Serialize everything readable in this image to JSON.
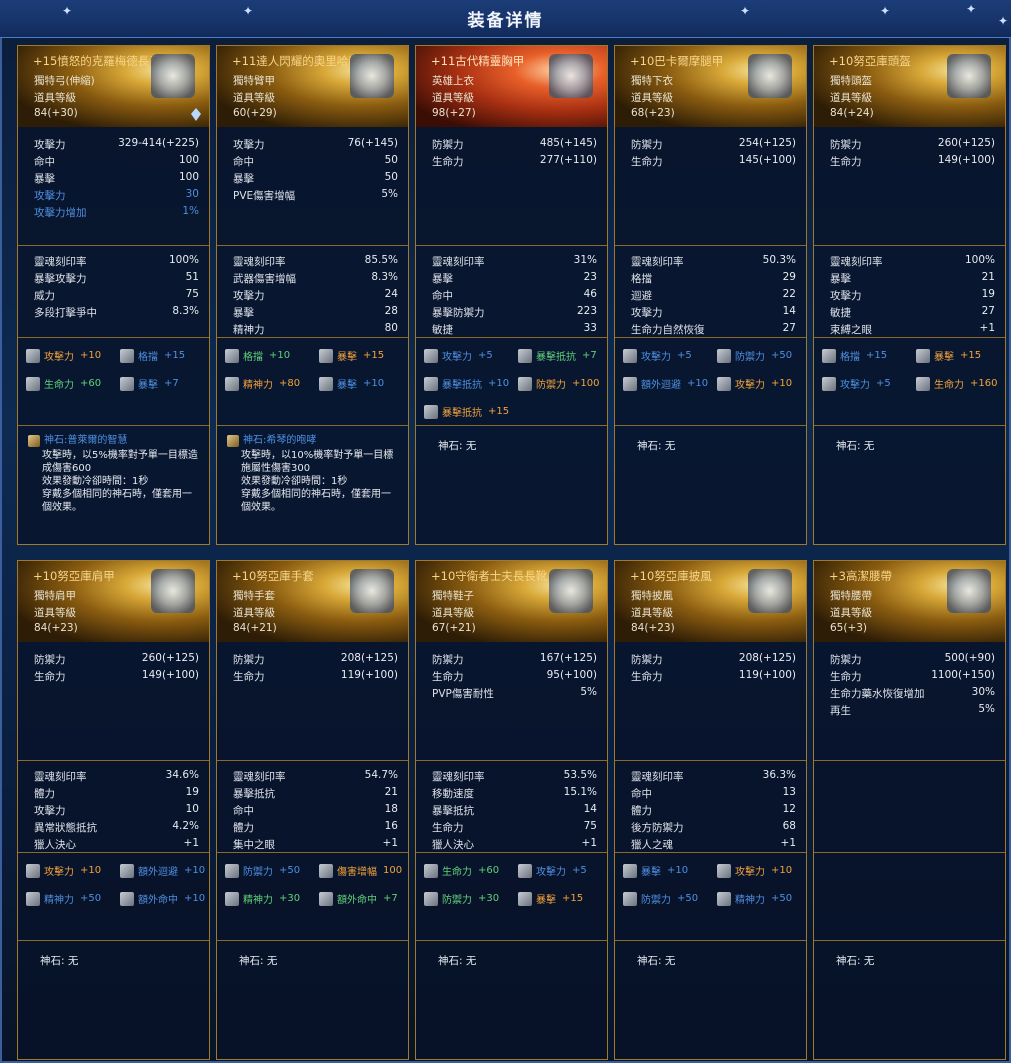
{
  "title": "装备详情",
  "cards": [
    {
      "name": "+15憤怒的克羅梅德長弓",
      "type": "獨特弓(伸縮)",
      "itemlevel_label": "道具等級",
      "level": "84(+30)",
      "red": false,
      "gem": true,
      "stats": [
        {
          "k": "攻擊力",
          "v": "329-414(+225)"
        },
        {
          "k": "命中",
          "v": "100"
        },
        {
          "k": "暴擊",
          "v": "100"
        },
        {
          "k": "攻擊力",
          "v": "30",
          "c": "blue"
        },
        {
          "k": "攻擊力增加",
          "v": "1%",
          "c": "blue"
        }
      ],
      "soul": [
        {
          "k": "靈魂刻印率",
          "v": "100%"
        },
        {
          "k": "暴擊攻擊力",
          "v": "51"
        },
        {
          "k": "威力",
          "v": "75"
        },
        {
          "k": "多段打擊爭中",
          "v": "8.3%"
        }
      ],
      "manastones": [
        {
          "n": "攻擊力",
          "v": "+10",
          "c": "or"
        },
        {
          "n": "格擋",
          "v": "+15",
          "c": "bl"
        },
        {
          "n": "生命力",
          "v": "+60",
          "c": "gr"
        },
        {
          "n": "暴擊",
          "v": "+7",
          "c": "bl"
        }
      ],
      "godstone": {
        "label": "神石:",
        "name": "普萊爾的智慧",
        "desc": "攻擊時，以5%機率對予單一目標造成傷害600\n效果發動冷卻時間：1秒\n穿戴多個相同的神石時，僅套用一個效果。"
      }
    },
    {
      "name": "+11達人閃耀的奧里哈康鐵甲",
      "type": "獨特臂甲",
      "itemlevel_label": "道具等級",
      "level": "60(+29)",
      "red": false,
      "gem": false,
      "stats": [
        {
          "k": "攻擊力",
          "v": "76(+145)"
        },
        {
          "k": "命中",
          "v": "50"
        },
        {
          "k": "暴擊",
          "v": "50"
        },
        {
          "k": "PVE傷害增幅",
          "v": "5%"
        }
      ],
      "soul": [
        {
          "k": "靈魂刻印率",
          "v": "85.5%"
        },
        {
          "k": "武器傷害增幅",
          "v": "8.3%"
        },
        {
          "k": "攻擊力",
          "v": "24"
        },
        {
          "k": "暴擊",
          "v": "28"
        },
        {
          "k": "精神力",
          "v": "80"
        }
      ],
      "manastones": [
        {
          "n": "格擋",
          "v": "+10",
          "c": "gr"
        },
        {
          "n": "暴擊",
          "v": "+15",
          "c": "or"
        },
        {
          "n": "精神力",
          "v": "+80",
          "c": "or"
        },
        {
          "n": "暴擊",
          "v": "+10",
          "c": "bl"
        }
      ],
      "godstone": {
        "label": "神石:",
        "name": "希琴的咆哮",
        "desc": "攻擊時，以10%機率對予單一目標施屬性傷害300\n效果發動冷卻時間：1秒\n穿戴多個相同的神石時，僅套用一個效果。"
      }
    },
    {
      "name": "+11古代精靈胸甲",
      "type": "英雄上衣",
      "itemlevel_label": "道具等級",
      "level": "98(+27)",
      "red": true,
      "gem": false,
      "stats": [
        {
          "k": "防禦力",
          "v": "485(+145)"
        },
        {
          "k": "生命力",
          "v": "277(+110)"
        }
      ],
      "soul": [
        {
          "k": "靈魂刻印率",
          "v": "31%"
        },
        {
          "k": "暴擊",
          "v": "23"
        },
        {
          "k": "命中",
          "v": "46"
        },
        {
          "k": "暴擊防禦力",
          "v": "223"
        },
        {
          "k": "敏捷",
          "v": "33"
        }
      ],
      "manastones": [
        {
          "n": "攻擊力",
          "v": "+5",
          "c": "bl"
        },
        {
          "n": "暴擊抵抗",
          "v": "+7",
          "c": "gr"
        },
        {
          "n": "暴擊抵抗",
          "v": "+10",
          "c": "bl"
        },
        {
          "n": "防禦力",
          "v": "+100",
          "c": "or"
        },
        {
          "n": "暴擊抵抗",
          "v": "+15",
          "c": "or"
        }
      ],
      "godstone": {
        "label": "神石:",
        "value": "无"
      }
    },
    {
      "name": "+10巴卡爾摩腿甲",
      "type": "獨特下衣",
      "itemlevel_label": "道具等級",
      "level": "68(+23)",
      "red": false,
      "gem": false,
      "stats": [
        {
          "k": "防禦力",
          "v": "254(+125)"
        },
        {
          "k": "生命力",
          "v": "145(+100)"
        }
      ],
      "soul": [
        {
          "k": "靈魂刻印率",
          "v": "50.3%"
        },
        {
          "k": "格擋",
          "v": "29"
        },
        {
          "k": "迴避",
          "v": "22"
        },
        {
          "k": "攻擊力",
          "v": "14"
        },
        {
          "k": "生命力自然恢復",
          "v": "27"
        }
      ],
      "manastones": [
        {
          "n": "攻擊力",
          "v": "+5",
          "c": "bl"
        },
        {
          "n": "防禦力",
          "v": "+50",
          "c": "bl"
        },
        {
          "n": "額外迴避",
          "v": "+10",
          "c": "bl"
        },
        {
          "n": "攻擊力",
          "v": "+10",
          "c": "or"
        }
      ],
      "godstone": {
        "label": "神石:",
        "value": "无"
      }
    },
    {
      "name": "+10努亞庫頭盔",
      "type": "獨特頭盔",
      "itemlevel_label": "道具等級",
      "level": "84(+24)",
      "red": false,
      "gem": false,
      "stats": [
        {
          "k": "防禦力",
          "v": "260(+125)"
        },
        {
          "k": "生命力",
          "v": "149(+100)"
        }
      ],
      "soul": [
        {
          "k": "靈魂刻印率",
          "v": "100%"
        },
        {
          "k": "暴擊",
          "v": "21"
        },
        {
          "k": "攻擊力",
          "v": "19"
        },
        {
          "k": "敏捷",
          "v": "27"
        },
        {
          "k": "束縛之眼",
          "v": "+1"
        }
      ],
      "manastones": [
        {
          "n": "格擋",
          "v": "+15",
          "c": "bl"
        },
        {
          "n": "暴擊",
          "v": "+15",
          "c": "or"
        },
        {
          "n": "攻擊力",
          "v": "+5",
          "c": "bl"
        },
        {
          "n": "生命力",
          "v": "+160",
          "c": "or"
        }
      ],
      "godstone": {
        "label": "神石:",
        "value": "无"
      }
    },
    {
      "name": "+10努亞庫肩甲",
      "type": "獨特肩甲",
      "itemlevel_label": "道具等級",
      "level": "84(+23)",
      "red": false,
      "gem": false,
      "stats": [
        {
          "k": "防禦力",
          "v": "260(+125)"
        },
        {
          "k": "生命力",
          "v": "149(+100)"
        }
      ],
      "soul": [
        {
          "k": "靈魂刻印率",
          "v": "34.6%"
        },
        {
          "k": "體力",
          "v": "19"
        },
        {
          "k": "攻擊力",
          "v": "10"
        },
        {
          "k": "異常狀態抵抗",
          "v": "4.2%"
        },
        {
          "k": "獵人決心",
          "v": "+1"
        }
      ],
      "manastones": [
        {
          "n": "攻擊力",
          "v": "+10",
          "c": "or"
        },
        {
          "n": "額外迴避",
          "v": "+10",
          "c": "bl"
        },
        {
          "n": "精神力",
          "v": "+50",
          "c": "bl"
        },
        {
          "n": "額外命中",
          "v": "+10",
          "c": "bl"
        }
      ],
      "godstone": {
        "label": "神石:",
        "value": "无"
      }
    },
    {
      "name": "+10努亞庫手套",
      "type": "獨特手套",
      "itemlevel_label": "道具等級",
      "level": "84(+21)",
      "red": false,
      "gem": false,
      "stats": [
        {
          "k": "防禦力",
          "v": "208(+125)"
        },
        {
          "k": "生命力",
          "v": "119(+100)"
        }
      ],
      "soul": [
        {
          "k": "靈魂刻印率",
          "v": "54.7%"
        },
        {
          "k": "暴擊抵抗",
          "v": "21"
        },
        {
          "k": "命中",
          "v": "18"
        },
        {
          "k": "體力",
          "v": "16"
        },
        {
          "k": "集中之眼",
          "v": "+1"
        }
      ],
      "manastones": [
        {
          "n": "防禦力",
          "v": "+50",
          "c": "bl"
        },
        {
          "n": "傷害增幅",
          "v": "100",
          "c": "or"
        },
        {
          "n": "精神力",
          "v": "+30",
          "c": "gr"
        },
        {
          "n": "額外命中",
          "v": "+7",
          "c": "gr"
        }
      ],
      "godstone": {
        "label": "神石:",
        "value": "无"
      }
    },
    {
      "name": "+10守衛者士夫長長靴",
      "type": "獨特鞋子",
      "itemlevel_label": "道具等級",
      "level": "67(+21)",
      "red": false,
      "gem": false,
      "stats": [
        {
          "k": "防禦力",
          "v": "167(+125)"
        },
        {
          "k": "生命力",
          "v": "95(+100)"
        },
        {
          "k": "PVP傷害耐性",
          "v": "5%"
        }
      ],
      "soul": [
        {
          "k": "靈魂刻印率",
          "v": "53.5%"
        },
        {
          "k": "移動速度",
          "v": "15.1%"
        },
        {
          "k": "暴擊抵抗",
          "v": "14"
        },
        {
          "k": "生命力",
          "v": "75"
        },
        {
          "k": "獵人決心",
          "v": "+1"
        }
      ],
      "manastones": [
        {
          "n": "生命力",
          "v": "+60",
          "c": "gr"
        },
        {
          "n": "攻擊力",
          "v": "+5",
          "c": "bl"
        },
        {
          "n": "防禦力",
          "v": "+30",
          "c": "gr"
        },
        {
          "n": "暴擊",
          "v": "+15",
          "c": "or"
        }
      ],
      "godstone": {
        "label": "神石:",
        "value": "无"
      }
    },
    {
      "name": "+10努亞庫披風",
      "type": "獨特披風",
      "itemlevel_label": "道具等級",
      "level": "84(+23)",
      "red": false,
      "gem": false,
      "stats": [
        {
          "k": "防禦力",
          "v": "208(+125)"
        },
        {
          "k": "生命力",
          "v": "119(+100)"
        }
      ],
      "soul": [
        {
          "k": "靈魂刻印率",
          "v": "36.3%"
        },
        {
          "k": "命中",
          "v": "13"
        },
        {
          "k": "體力",
          "v": "12"
        },
        {
          "k": "後方防禦力",
          "v": "68"
        },
        {
          "k": "獵人之魂",
          "v": "+1"
        }
      ],
      "manastones": [
        {
          "n": "暴擊",
          "v": "+10",
          "c": "bl"
        },
        {
          "n": "攻擊力",
          "v": "+10",
          "c": "or"
        },
        {
          "n": "防禦力",
          "v": "+50",
          "c": "bl"
        },
        {
          "n": "精神力",
          "v": "+50",
          "c": "bl"
        }
      ],
      "godstone": {
        "label": "神石:",
        "value": "无"
      }
    },
    {
      "name": "+3高潔腰帶",
      "type": "獨特腰帶",
      "itemlevel_label": "道具等級",
      "level": "65(+3)",
      "red": false,
      "gem": false,
      "stats": [
        {
          "k": "防禦力",
          "v": "500(+90)"
        },
        {
          "k": "生命力",
          "v": "1100(+150)"
        },
        {
          "k": "生命力藥水恢復增加",
          "v": "30%"
        },
        {
          "k": "再生",
          "v": "5%"
        }
      ],
      "soul": [],
      "manastones": [],
      "godstone": {
        "label": "神石:",
        "value": "无"
      }
    }
  ]
}
